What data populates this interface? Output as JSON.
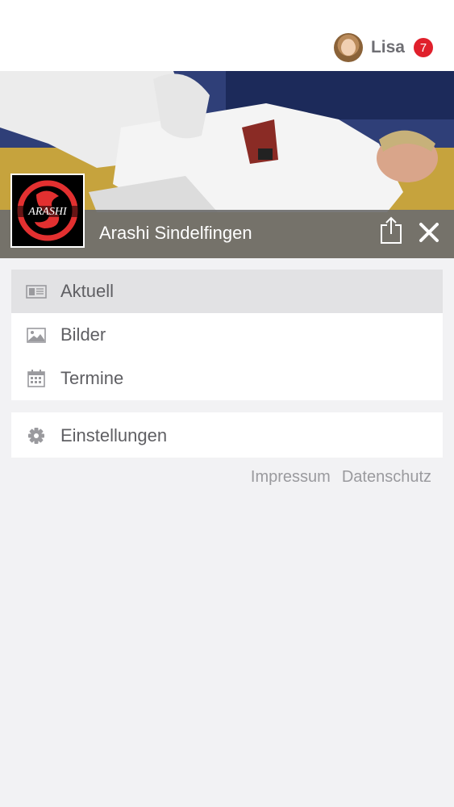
{
  "header": {
    "user_name": "Lisa",
    "notification_count": "7"
  },
  "club": {
    "name": "Arashi Sindelfingen",
    "logo_text": "ARASHI"
  },
  "menu": {
    "items": [
      {
        "label": "Aktuell",
        "icon": "newspaper-icon",
        "active": true
      },
      {
        "label": "Bilder",
        "icon": "image-icon",
        "active": false
      },
      {
        "label": "Termine",
        "icon": "calendar-icon",
        "active": false
      }
    ],
    "settings": {
      "label": "Einstellungen",
      "icon": "gear-icon"
    }
  },
  "footer": {
    "impressum": "Impressum",
    "datenschutz": "Datenschutz"
  },
  "colors": {
    "badge": "#e0202c",
    "active_item": "#e2e2e4",
    "background": "#f2f2f4"
  }
}
